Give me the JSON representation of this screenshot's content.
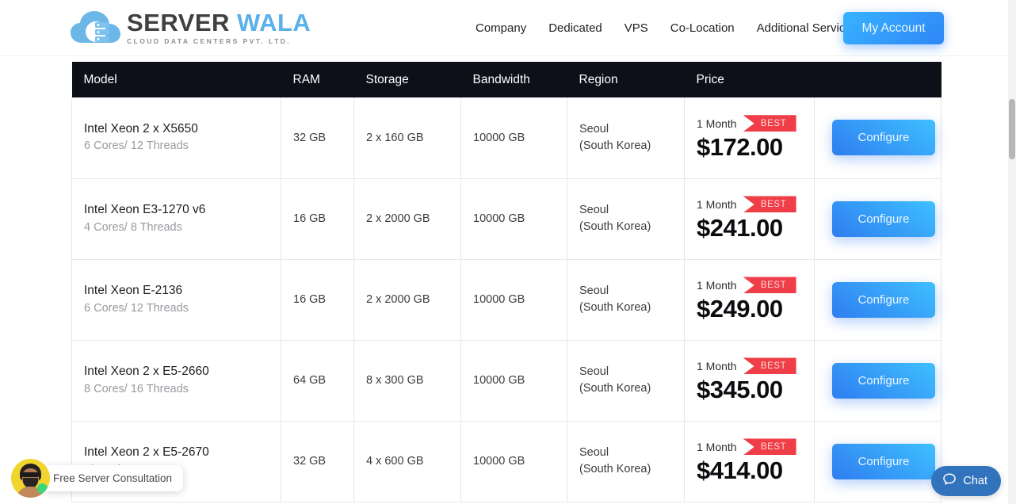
{
  "header": {
    "logo": {
      "icon": "cloud-server-logo",
      "title_first": "SERVER",
      "title_second": "WALA",
      "subtitle": "CLOUD DATA CENTERS PVT. LTD.",
      "color_primary": "#404042",
      "color_accent": "#59b0ea"
    },
    "nav": [
      {
        "label": "Company"
      },
      {
        "label": "Dedicated"
      },
      {
        "label": "VPS"
      },
      {
        "label": "Co-Location"
      },
      {
        "label": "Additional Services"
      }
    ],
    "account_button": {
      "label": "My Account",
      "color": "#2f86f6"
    }
  },
  "table": {
    "columns": [
      {
        "key": "model",
        "label": "Model"
      },
      {
        "key": "ram",
        "label": "RAM"
      },
      {
        "key": "storage",
        "label": "Storage"
      },
      {
        "key": "bandwidth",
        "label": "Bandwidth"
      },
      {
        "key": "region",
        "label": "Region"
      },
      {
        "key": "price",
        "label": "Price"
      },
      {
        "key": "action",
        "label": ""
      }
    ],
    "header_background": "#0d1019",
    "rows": [
      {
        "model": "Intel Xeon 2 x X5650",
        "spec": "6 Cores/ 12 Threads",
        "ram": "32 GB",
        "storage": "2 x 160 GB",
        "bandwidth": "10000 GB",
        "region_city": "Seoul",
        "region_country": "(South Korea)",
        "term": "1 Month",
        "badge": "BEST",
        "price": "$172.00",
        "action": "Configure"
      },
      {
        "model": "Intel Xeon E3-1270 v6",
        "spec": "4 Cores/ 8 Threads",
        "ram": "16 GB",
        "storage": "2 x 2000 GB",
        "bandwidth": "10000 GB",
        "region_city": "Seoul",
        "region_country": "(South Korea)",
        "term": "1 Month",
        "badge": "BEST",
        "price": "$241.00",
        "action": "Configure"
      },
      {
        "model": "Intel Xeon E-2136",
        "spec": "6 Cores/ 12 Threads",
        "ram": "16 GB",
        "storage": "2 x 2000 GB",
        "bandwidth": "10000 GB",
        "region_city": "Seoul",
        "region_country": "(South Korea)",
        "term": "1 Month",
        "badge": "BEST",
        "price": "$249.00",
        "action": "Configure"
      },
      {
        "model": "Intel Xeon 2 x E5-2660",
        "spec": "8 Cores/ 16 Threads",
        "ram": "64 GB",
        "storage": "8 x 300 GB",
        "bandwidth": "10000 GB",
        "region_city": "Seoul",
        "region_country": "(South Korea)",
        "term": "1 Month",
        "badge": "BEST",
        "price": "$345.00",
        "action": "Configure"
      },
      {
        "model": "Intel Xeon 2 x E5-2670",
        "spec": "Threads",
        "ram": "32 GB",
        "storage": "4 x 600 GB",
        "bandwidth": "10000 GB",
        "region_city": "Seoul",
        "region_country": "(South Korea)",
        "term": "1 Month",
        "badge": "BEST",
        "price": "$414.00",
        "action": "Configure"
      }
    ],
    "badge_color": "#ef3e47",
    "configure_color": "#2f7df0"
  },
  "widgets": {
    "consultation": {
      "avatar_icon": "support-agent-avatar",
      "status": "online",
      "label": "Free Server Consultation"
    },
    "chat": {
      "icon": "chat-bubble-icon",
      "label": "Chat",
      "color": "#3273bd"
    }
  }
}
